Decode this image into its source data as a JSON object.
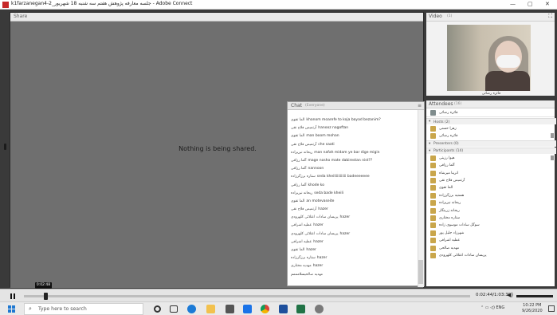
{
  "window": {
    "title": "k1farzanegan4-2_جلسه معارفه پژوهش هفتم سه شنبه 18 شهریور - Adobe Connect",
    "controls": [
      "—",
      "▢",
      "✕"
    ]
  },
  "share_pod": {
    "title": "Share",
    "message": "Nothing is being shared."
  },
  "chat_pod": {
    "title": "Chat",
    "scope": "(Everyone)",
    "messages": [
      {
        "who": "الما تقوی",
        "text": "khanom moarefe to koja bayad bezanim?"
      },
      {
        "who": "آرتمیس فلاح نقی",
        "text": "hanooz nagoftan"
      },
      {
        "who": "الما تقوی",
        "text": "man boom mohan"
      },
      {
        "who": "آرتمیس فلاح نقی",
        "text": "che saati"
      },
      {
        "who": "ریحانه نیزیزاده",
        "text": "man nafah midam ye bar dige migin"
      },
      {
        "who": "آلما رزاقی",
        "text": "mage nosho mate dabirestan nist??"
      },
      {
        "who": "آلما رزاقی",
        "text": "nannoon"
      },
      {
        "who": "ستاره برزگرزاده",
        "text": "seda kheiliiiiiiiiiii badeeeeeee"
      },
      {
        "who": "آلما رزاقی",
        "text": "khode ko"
      },
      {
        "who": "ریحانه نیزیزاده",
        "text": "seda bade kheili"
      },
      {
        "who": "الما تقوی",
        "text": "an motevaseite"
      },
      {
        "who": "آرتمیس فلاح نقی",
        "text": "hazer"
      },
      {
        "who": "پریسان سادات اعتلائی کلهرودی",
        "text": "hazer"
      },
      {
        "who": "عطیه اشرافی",
        "text": "hazer"
      },
      {
        "who": "پریسان سادات اعتلائی کلهرودی",
        "text": "hazer"
      },
      {
        "who": "عطیه اشرافی",
        "text": "hazer"
      },
      {
        "who": "الما تقوی",
        "text": "hazer"
      },
      {
        "who": "ستاره برزگرزاده",
        "text": "hazer"
      },
      {
        "who": "مهدیه مختاری",
        "text": "hazer"
      },
      {
        "who": "مهدیه صالحی",
        "text": "سلامممم"
      }
    ]
  },
  "video_pod": {
    "title": "Video",
    "count": "(1)",
    "caption": "فائزه رضائی"
  },
  "attendees_pod": {
    "title": "Attendees",
    "count": "(16)",
    "me": "فائزه رضائی",
    "hosts_label": "Hosts (2)",
    "hosts": [
      "زهرا حسنی",
      "فائزه رضائی"
    ],
    "presenters_label": "Presenters (0)",
    "participants_label": "Participants (14)",
    "participants": [
      "هیوا رزیتی",
      "آلما رزاقی",
      "اترینا میرشاه",
      "آرتمیس فلاح نقی",
      "الما تقوی",
      "هستیه برزگرزاده",
      "ریحانه نیزیزاده",
      "ریحانه زرینگار",
      "ستاره مختاری",
      "سوگل سادات موسوی زاده",
      "شهرزاد جلیل پور",
      "عطیه اشرافی",
      "مهدیه صالحی",
      "پریسان سادات اعتلائی کلهرودی"
    ]
  },
  "playback": {
    "tooltip": "0:02:48",
    "time": "0:02:44/1:03:39",
    "progress": 0.045
  },
  "taskbar": {
    "search_placeholder": "Type here to search",
    "tray_lang": "ENG",
    "time": "10:22 PM",
    "date": "9/26/2020"
  }
}
